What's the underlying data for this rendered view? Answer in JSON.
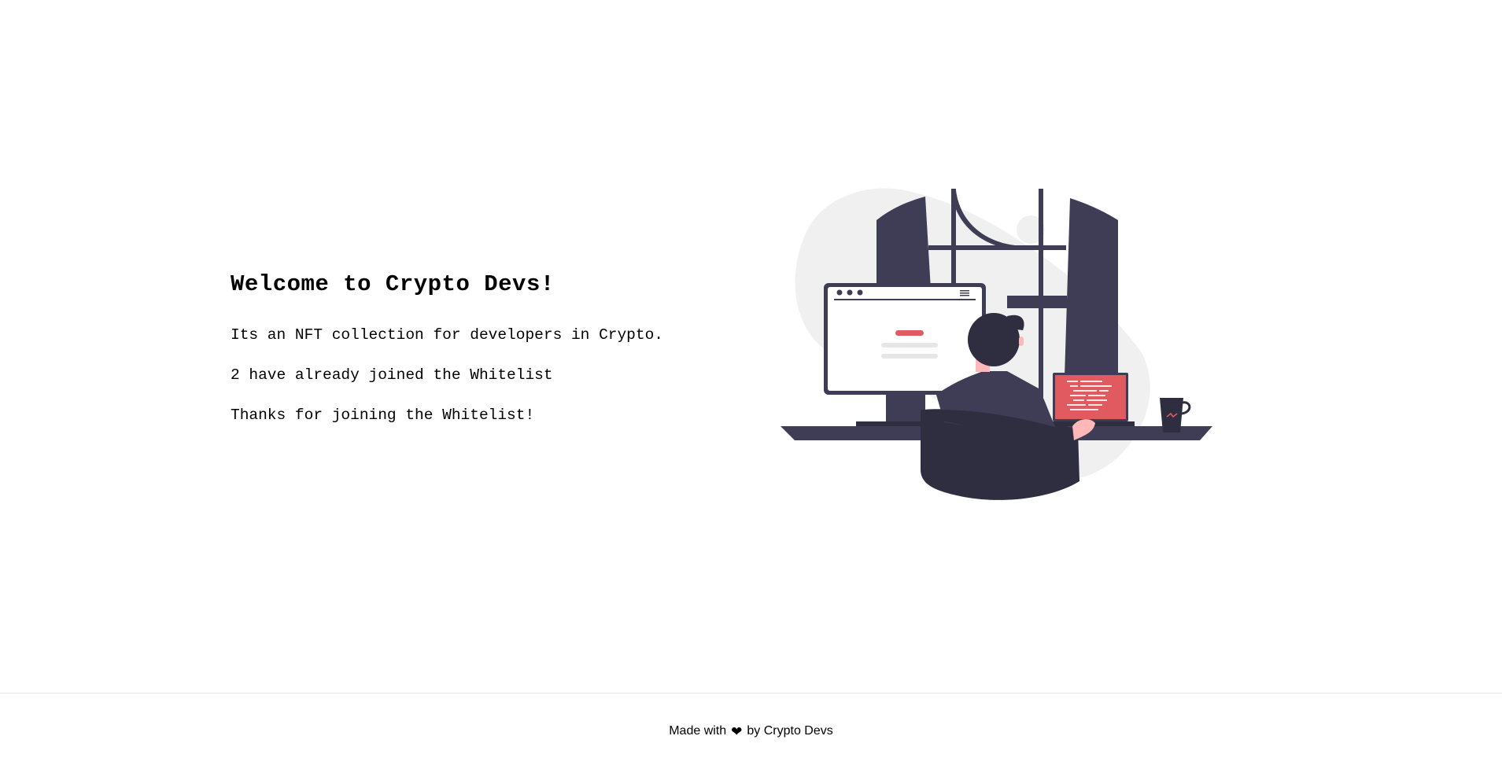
{
  "hero": {
    "title": "Welcome to Crypto Devs!",
    "description": "Its an NFT collection for developers in Crypto.",
    "whitelist_count_text": "2 have already joined the Whitelist",
    "status_message": "Thanks for joining the Whitelist!"
  },
  "illustration": {
    "icon": "developer-at-desk-illustration",
    "colors": {
      "dark": "#3f3d56",
      "darker": "#2f2e41",
      "accent": "#e05a5f",
      "skin": "#ffb8b8",
      "blob": "#f0f0f0"
    }
  },
  "footer": {
    "prefix": "Made with",
    "heart_icon": "heart-icon",
    "heart_glyph": "❤",
    "suffix": "by Crypto Devs"
  }
}
